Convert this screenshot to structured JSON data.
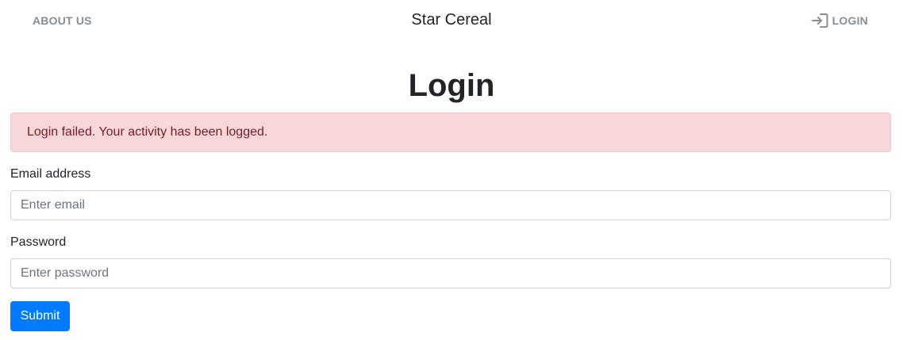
{
  "nav": {
    "about_label": "ABOUT US",
    "brand": "Star Cereal",
    "login_label": "LOGIN",
    "login_icon": "login-arrow-icon",
    "muted_color": "#868e96"
  },
  "page": {
    "title": "Login"
  },
  "alert": {
    "message": "Login failed. Your activity has been logged.",
    "background": "#f8d7da",
    "text_color": "#721c24"
  },
  "form": {
    "email": {
      "label": "Email address",
      "placeholder": "Enter email",
      "value": ""
    },
    "password": {
      "label": "Password",
      "placeholder": "Enter password",
      "value": ""
    },
    "submit_label": "Submit",
    "submit_color": "#007bff"
  }
}
